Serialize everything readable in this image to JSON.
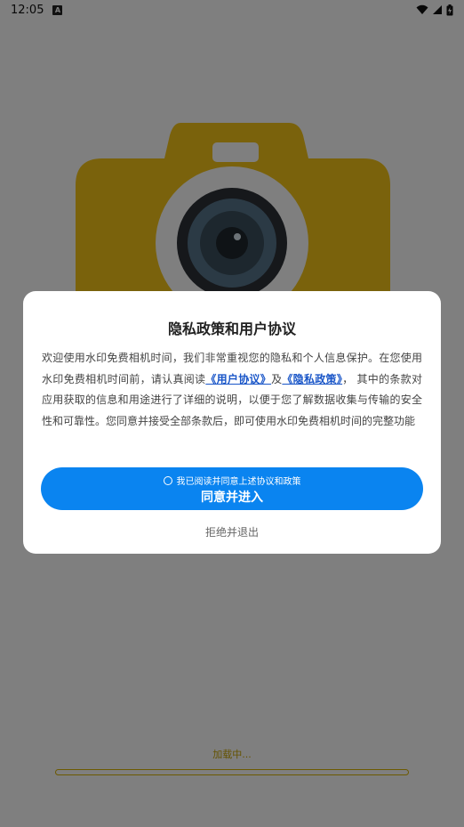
{
  "status_bar": {
    "time": "12:05",
    "notification_icon": "a-icon",
    "wifi_icon": "wifi-icon",
    "signal_icon": "signal-icon",
    "battery_icon": "battery-charging-icon"
  },
  "splash": {
    "logo_icon": "camera-icon",
    "loading_text": "加载中...",
    "progress": 0,
    "accent_color": "#f5c518"
  },
  "dialog": {
    "title": "隐私政策和用户协议",
    "body": {
      "part1": "欢迎使用水印免费相机时间，我们非常重视您的隐私和个人信息保护。在您使用水印免费相机时间前，请认真阅读",
      "user_agreement_link": "《用户协议》",
      "and": "及",
      "privacy_policy_link": "《隐私政策》",
      "part2": "， 其中的条款对应用获取的信息和用途进行了详细的说明，以便于您了解数据收集与传输的安全性和可靠性。您同意并接受全部条款后，即可使用水印免费相机时间的完整功能"
    },
    "consent_checkbox_label": "我已阅读并同意上述协议和政策",
    "agree_button": "同意并进入",
    "reject_button": "拒绝并退出",
    "primary_color": "#0a84f0",
    "link_color": "#1a56c8"
  }
}
